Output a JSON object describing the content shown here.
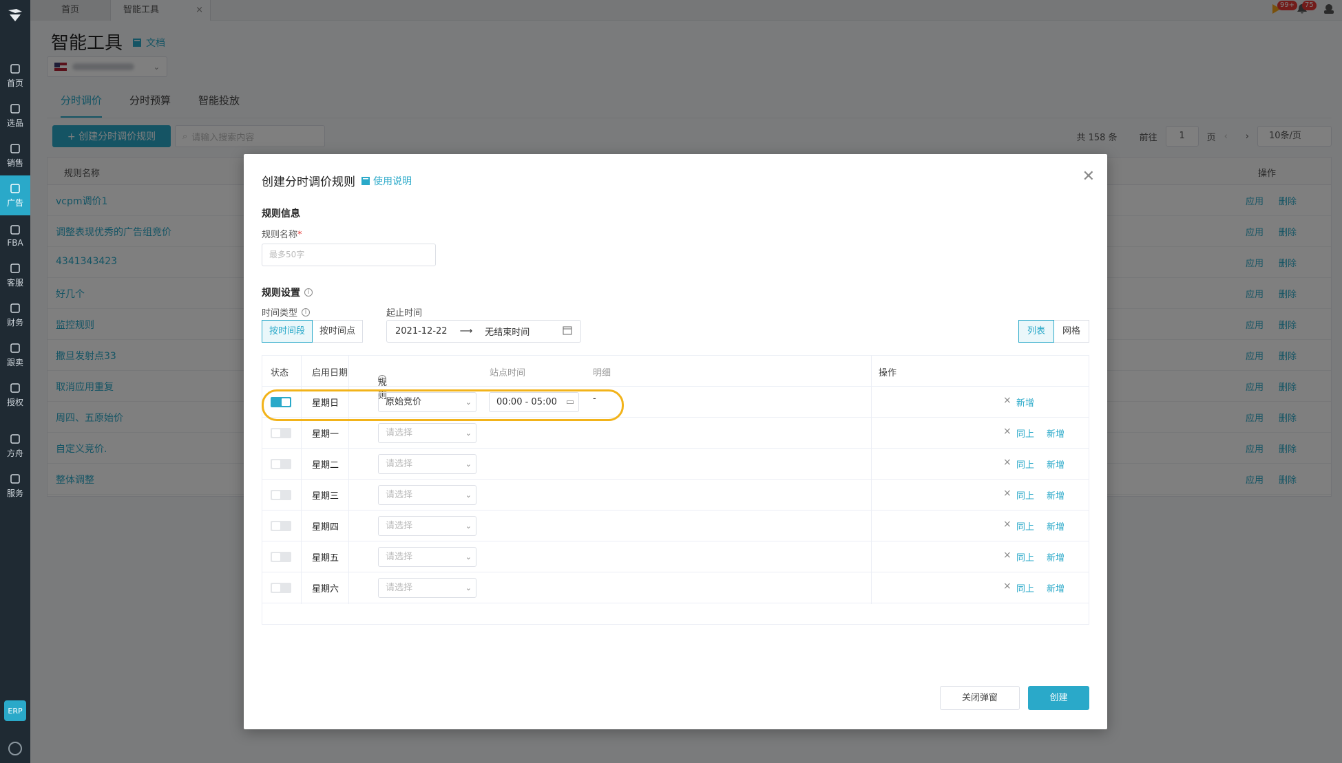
{
  "sidebar": {
    "items": [
      {
        "label": "首页",
        "icon": "home-icon"
      },
      {
        "label": "选品",
        "icon": "search-icon"
      },
      {
        "label": "销售",
        "icon": "chart-icon"
      },
      {
        "label": "广告",
        "icon": "ad-icon",
        "active": true
      },
      {
        "label": "FBA",
        "icon": "box-icon"
      },
      {
        "label": "客服",
        "icon": "report-icon"
      },
      {
        "label": "财务",
        "icon": "dollar-icon"
      },
      {
        "label": "跟卖",
        "icon": "pie-icon"
      },
      {
        "label": "授权",
        "icon": "shield-icon"
      },
      {
        "label": "方舟",
        "icon": "ark-icon"
      },
      {
        "label": "服务",
        "icon": "service-icon"
      }
    ],
    "erp_label": "ERP"
  },
  "tabs": [
    {
      "label": "首页"
    },
    {
      "label": "智能工具",
      "closable": true
    }
  ],
  "header": {
    "badge_messages": "99+",
    "badge_notifications": "75"
  },
  "page": {
    "title": "智能工具",
    "doc_link": "文档",
    "subtabs": [
      "分时调价",
      "分时预算",
      "智能投放"
    ],
    "create_button": "+ 创建分时调价规则",
    "search_placeholder": "请输入搜索内容",
    "total": "共 158 条",
    "goto_label": "前往",
    "page_number": "1",
    "page_unit": "页",
    "page_size": "10条/页",
    "table": {
      "col_name": "规则名称",
      "col_ops": "操作",
      "op_apply": "应用",
      "op_delete": "删除",
      "rows": [
        "vcpm调价1",
        "调整表现优秀的广告组竞价",
        "4341343423",
        "好几个",
        "监控规则",
        "撒旦发射点33",
        "取消应用重复",
        "周四、五原始价",
        "自定义竞价.",
        "整体调整"
      ]
    }
  },
  "modal": {
    "title": "创建分时调价规则",
    "help_link": "使用说明",
    "section_info": "规则信息",
    "rule_name_label": "规则名称",
    "required_mark": "*",
    "rule_name_placeholder": "最多50字",
    "section_settings": "规则设置",
    "time_type_label": "时间类型",
    "time_type_options": [
      "按时间段",
      "按时间点"
    ],
    "date_range_label": "起止时间",
    "date_start": "2021-12-22",
    "date_arrow": "⟶",
    "date_end": "无结束时间",
    "view_list": "列表",
    "view_grid": "网格",
    "table": {
      "col_status": "状态",
      "col_date": "启用日期",
      "col_rule": "规则",
      "col_site_time": "站点时间",
      "col_detail": "明细",
      "col_ops": "操作",
      "op_same": "同上",
      "op_add": "新增",
      "rows": [
        {
          "on": true,
          "day": "星期日",
          "rule": "原始竞价",
          "time": "00:00 - 05:00",
          "detail": "-"
        },
        {
          "on": false,
          "day": "星期一",
          "rule": "请选择"
        },
        {
          "on": false,
          "day": "星期二",
          "rule": "请选择"
        },
        {
          "on": false,
          "day": "星期三",
          "rule": "请选择"
        },
        {
          "on": false,
          "day": "星期四",
          "rule": "请选择"
        },
        {
          "on": false,
          "day": "星期五",
          "rule": "请选择"
        },
        {
          "on": false,
          "day": "星期六",
          "rule": "请选择"
        }
      ]
    },
    "cancel_button": "关闭弹窗",
    "create_button": "创建"
  },
  "colors": {
    "accent": "#2aa9c9",
    "sidebar_bg": "#1f2a33",
    "highlight": "#f2b31a"
  }
}
